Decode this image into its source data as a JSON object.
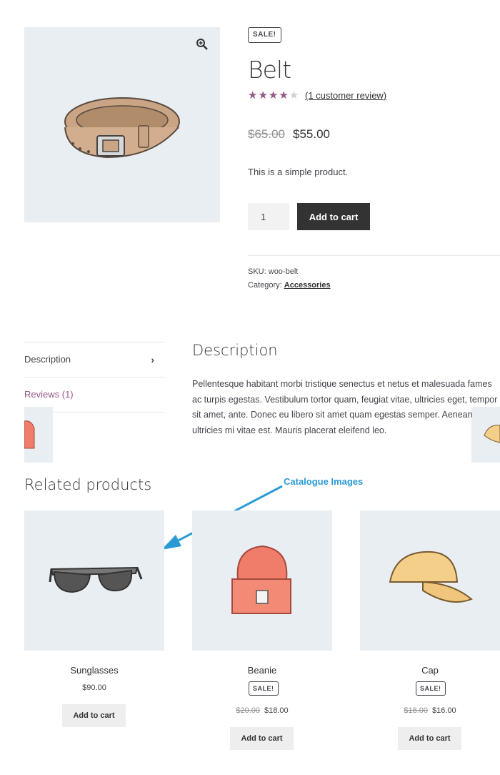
{
  "product": {
    "sale_badge": "SALE!",
    "title": "Belt",
    "rating": 4,
    "rating_max": 5,
    "review_link": "(1 customer review)",
    "price_old": "$65.00",
    "price_new": "$55.00",
    "short_description": "This is a simple product.",
    "quantity": "1",
    "add_to_cart": "Add to cart",
    "sku_label": "SKU:",
    "sku_value": "woo-belt",
    "category_label": "Category:",
    "category_value": "Accessories"
  },
  "tabs": [
    {
      "label": "Description",
      "active": true
    },
    {
      "label": "Reviews (1)",
      "active": false
    }
  ],
  "description": {
    "heading": "Description",
    "text": "Pellentesque habitant morbi tristique senectus et netus et malesuada fames ac turpis egestas. Vestibulum tortor quam, feugiat vitae, ultricies eget, tempor sit amet, ante. Donec eu libero sit amet quam egestas semper. Aenean ultricies mi vitae est. Mauris placerat eleifend leo."
  },
  "related": {
    "heading": "Related products",
    "annotation": "Catalogue Images",
    "products": [
      {
        "name": "Sunglasses",
        "price": "$90.00",
        "old_price": "",
        "sale": "",
        "button": "Add to cart"
      },
      {
        "name": "Beanie",
        "price": "$18.00",
        "old_price": "$20.00",
        "sale": "SALE!",
        "button": "Add to cart"
      },
      {
        "name": "Cap",
        "price": "$16.00",
        "old_price": "$18.00",
        "sale": "SALE!",
        "button": "Add to cart"
      }
    ]
  },
  "colors": {
    "accent": "#96588a",
    "image_bg": "#e9eef3",
    "button_dark": "#333333",
    "annotation": "#2a9ad6"
  },
  "icons": [
    "zoom-in-icon",
    "star-icon",
    "chevron-right-icon",
    "arrow-annotation-icon"
  ]
}
